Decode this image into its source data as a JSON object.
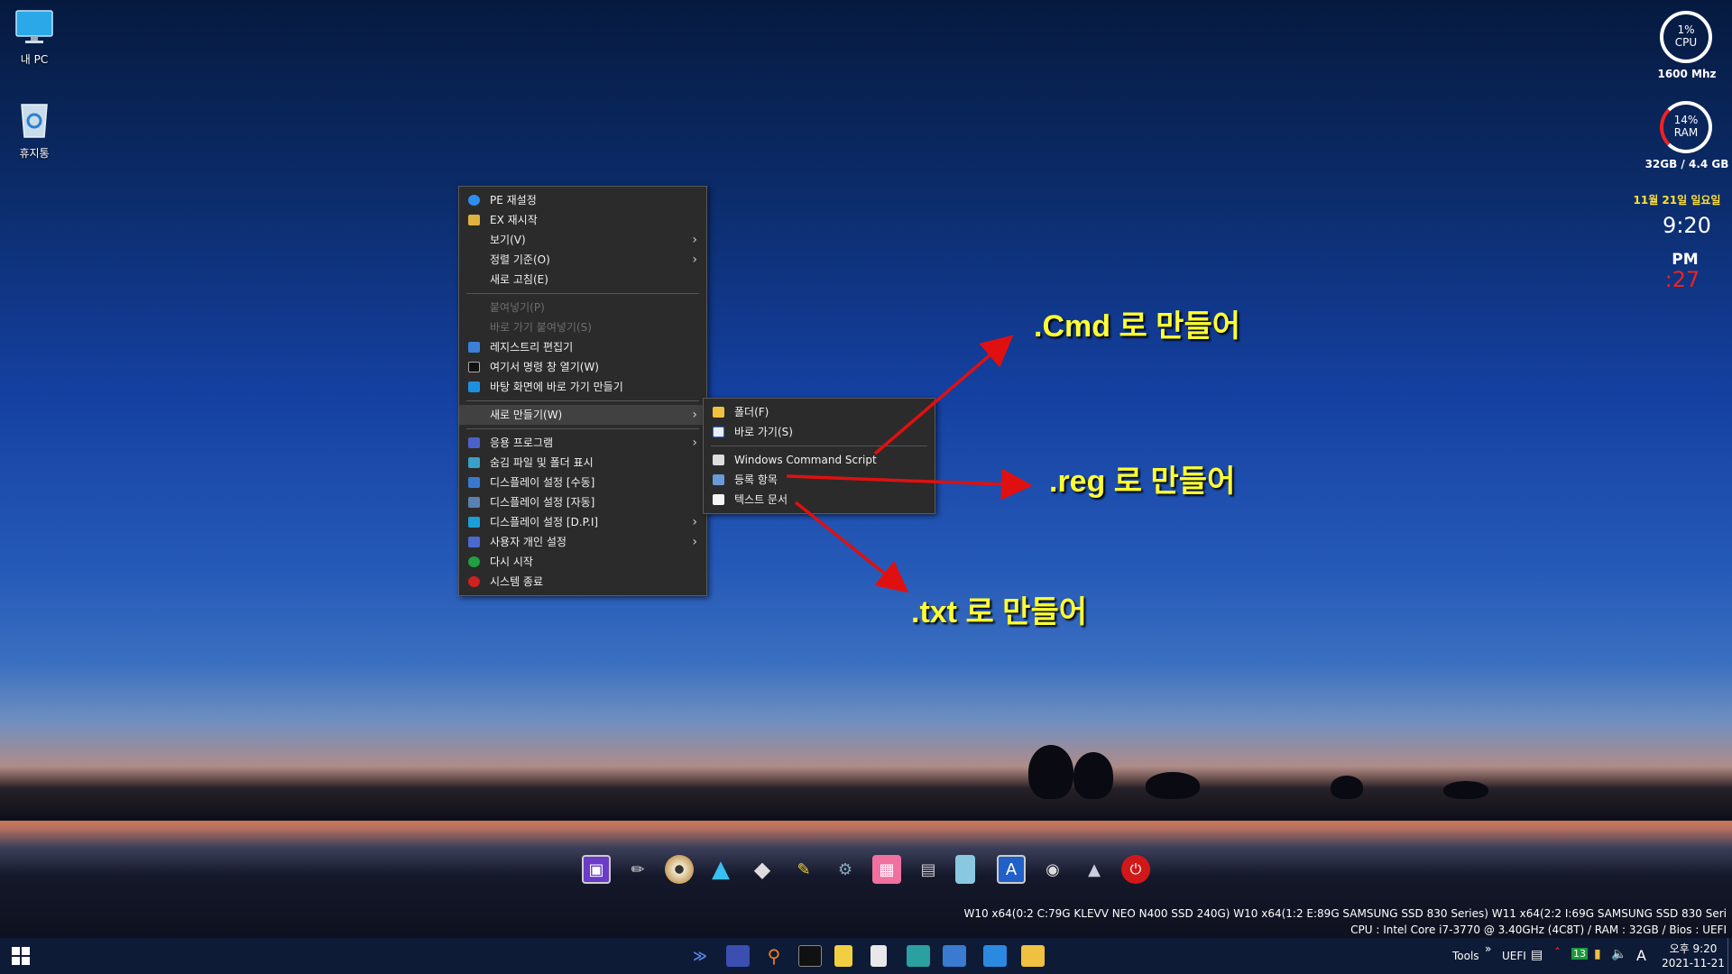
{
  "desktop": {
    "icons": [
      {
        "label": "내 PC",
        "icon": "monitor-icon"
      },
      {
        "label": "휴지통",
        "icon": "recycle-bin-icon"
      }
    ]
  },
  "gadgets": {
    "cpu": {
      "percent": "1%",
      "label": "CPU",
      "freq": "1600 Mhz"
    },
    "ram": {
      "percent": "14%",
      "label": "RAM",
      "detail": "32GB / 4.4 GB"
    },
    "clock": {
      "date": "11월 21일 일요일",
      "time": "9:20",
      "ampm": "PM",
      "seconds": ":27"
    }
  },
  "context_menu": {
    "items": [
      {
        "label": "PE 재설정",
        "icon": "refresh-icon"
      },
      {
        "label": "EX 재시작",
        "icon": "explorer-icon"
      },
      {
        "label": "보기(V)",
        "submenu": true
      },
      {
        "label": "정렬 기준(O)",
        "submenu": true
      },
      {
        "label": "새로 고침(E)"
      },
      {
        "label": "붙여넣기(P)",
        "disabled": true
      },
      {
        "label": "바로 가기 붙여넣기(S)",
        "disabled": true
      },
      {
        "label": "레지스트리 편집기",
        "icon": "regedit-icon"
      },
      {
        "label": "여기서 명령 창 열기(W)",
        "icon": "cmd-icon"
      },
      {
        "label": "바탕 화면에 바로 가기 만들기",
        "icon": "desktop-shortcut-icon"
      },
      {
        "label": "새로 만들기(W)",
        "submenu": true
      },
      {
        "label": "응용 프로그램",
        "icon": "apps-icon",
        "submenu": true
      },
      {
        "label": "숨김 파일 및 폴더 표시",
        "icon": "hidden-files-icon"
      },
      {
        "label": "디스플레이 설정 [수동]",
        "icon": "display-icon"
      },
      {
        "label": "디스플레이 설정 [자동]",
        "icon": "display-auto-icon"
      },
      {
        "label": "디스플레이 설정 [D.P.I]",
        "icon": "display-dpi-icon",
        "submenu": true
      },
      {
        "label": "사용자 개인 설정",
        "icon": "personalize-icon",
        "submenu": true
      },
      {
        "label": "다시 시작",
        "icon": "restart-icon"
      },
      {
        "label": "시스템 종료",
        "icon": "shutdown-icon"
      }
    ]
  },
  "submenu_new": {
    "items": [
      {
        "label": "폴더(F)",
        "icon": "folder-icon"
      },
      {
        "label": "바로 가기(S)",
        "icon": "shortcut-icon"
      },
      {
        "label": "Windows Command Script",
        "icon": "cmd-script-icon"
      },
      {
        "label": "등록 항목",
        "icon": "reg-file-icon"
      },
      {
        "label": "텍스트 문서",
        "icon": "text-doc-icon"
      }
    ]
  },
  "annotations": {
    "cmd": ".Cmd 로 만들어",
    "reg": ".reg 로 만들어",
    "txt": ".txt 로 만들어"
  },
  "info_lines": {
    "disks": "W10  x64(0:2 C:79G KLEVV NEO N400 SSD 240G) W10  x64(1:2 E:89G SAMSUNG SSD 830 Series) W11  x64(2:2 I:69G SAMSUNG SSD 830 Seri",
    "cpu": "CPU : Intel Core i7-3770 @ 3.40GHz (4C8T) / RAM : 32GB / Bios : UEFI"
  },
  "taskbar": {
    "tools": "Tools",
    "uefi": "UEFI",
    "ime": "A",
    "time": "오후 9:20",
    "date": "2021-11-21",
    "badge": "13"
  },
  "colors": {
    "accent_yellow": "#ffff33",
    "arrow_red": "#e01010",
    "menu_bg": "#2b2b2b"
  }
}
